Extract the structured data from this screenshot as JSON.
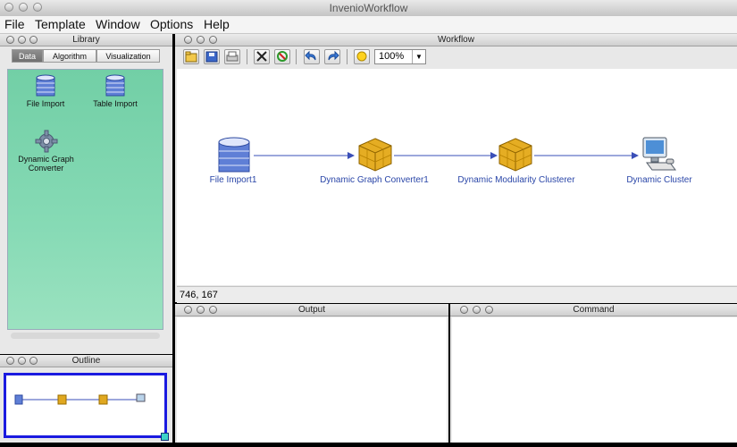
{
  "window": {
    "title": "InvenioWorkflow"
  },
  "menu": {
    "items": [
      "File",
      "Template",
      "Window",
      "Options",
      "Help"
    ]
  },
  "library": {
    "title": "Library",
    "tabs": [
      "Data",
      "Algorithm",
      "Visualization"
    ],
    "active_tab": "Data",
    "items": [
      {
        "label": "File Import",
        "icon": "database-icon"
      },
      {
        "label": "Table Import",
        "icon": "table-database-icon"
      },
      {
        "label_line1": "Dynamic Graph",
        "label_line2": "Converter",
        "icon": "gear-icon"
      }
    ]
  },
  "outline": {
    "title": "Outline"
  },
  "workflow": {
    "title": "Workflow",
    "zoom": "100%",
    "toolbar_icons": [
      "open-folder-icon",
      "save-icon",
      "print-icon",
      "delete-icon",
      "run-icon",
      "undo-icon",
      "redo-icon",
      "lightbulb-icon"
    ],
    "nodes": [
      {
        "label": "File Import1",
        "icon": "database-icon"
      },
      {
        "label": "Dynamic Graph Converter1",
        "icon": "cube-icon"
      },
      {
        "label": "Dynamic Modularity Clusterer",
        "icon": "cube-icon"
      },
      {
        "label": "Dynamic Cluster",
        "icon": "computer-icon"
      }
    ],
    "coordinates": "746, 167"
  },
  "output": {
    "title": "Output"
  },
  "command": {
    "title": "Command"
  }
}
